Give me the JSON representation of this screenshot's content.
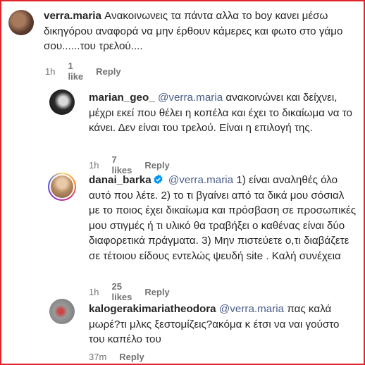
{
  "comments": [
    {
      "username": "verra.maria",
      "mention": "",
      "text": "Ανακοινωνεις τα πάντα αλλα το boy κανει μέσω δικηγόρου αναφορά να μην έρθουν κάμερες και φωτο στο γάμο σου......του τρελού....",
      "time": "1h",
      "likes": "1 like",
      "reply": "Reply",
      "avatar_color": "#6b4a3a"
    },
    {
      "username": "marian_geo_",
      "mention": "@verra.maria",
      "text": "ανακοινώνει και δείχνει, μέχρι εκεί που θέλει η κοπέλα και έχει το δικαίωμα να το κάνει. Δεν είναι του τρελού. Είναι η επιλογή της.",
      "time": "1h",
      "likes": "7 likes",
      "reply": "Reply",
      "avatar_color": "#3a3a3a"
    },
    {
      "username": "danai_barka",
      "verified": true,
      "mention": "@verra.maria",
      "text": "1) είναι αναληθές όλο αυτό που λέτε. 2) το τι βγαίνει από τα δικά μου σόσιαλ με το ποιος έχει δικαίωμα και πρόσβαση σε προσωπικές μου στιγμές ή τι υλικό θα τραβήξει ο καθένας είναι δύο διαφορετικά πράγματα. 3) Μην πιστεύετε ο,τι διαβάζετε σε τέτοιου είδους εντελώς ψευδή site . Καλή συνέχεια",
      "time": "1h",
      "likes": "25 likes",
      "reply": "Reply",
      "avatar_color": "#c9a37a"
    },
    {
      "username": "kalogerakimariatheodora",
      "mention": "@verra.maria",
      "text": "πας καλά μωρέ?τι μλκς ξεστομίζεις?ακόμα κ έτσι να ναι γούστο του καπέλο του",
      "time": "37m",
      "likes": "",
      "reply": "Reply",
      "avatar_color": "#a8a8a8"
    }
  ]
}
